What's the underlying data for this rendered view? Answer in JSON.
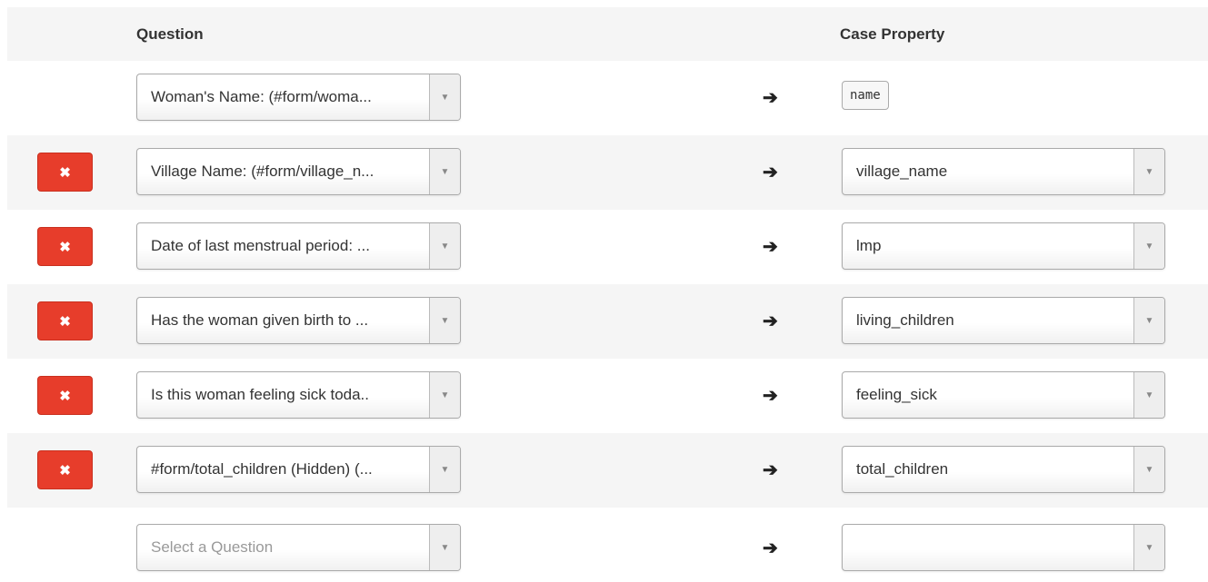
{
  "headers": {
    "question": "Question",
    "case_property": "Case Property"
  },
  "delete_symbol": "✖",
  "dropdown_symbol": "▼",
  "mapping_arrow": "➔",
  "rows": [
    {
      "question": "Woman's Name: (#form/woma...",
      "property": "name",
      "property_fixed": true,
      "deletable": false
    },
    {
      "question": "Village Name: (#form/village_n...",
      "property": "village_name",
      "deletable": true
    },
    {
      "question": "Date of last menstrual period: ...",
      "property": "lmp",
      "deletable": true
    },
    {
      "question": "Has the woman given birth to ...",
      "property": "living_children",
      "deletable": true
    },
    {
      "question": "Is this woman feeling sick toda..",
      "property": "feeling_sick",
      "deletable": true
    },
    {
      "question": "#form/total_children (Hidden) (...",
      "property": "total_children",
      "deletable": true
    },
    {
      "question": "",
      "question_placeholder": "Select a Question",
      "property": "",
      "deletable": false
    }
  ],
  "colors": {
    "delete_button": "#e73d2b",
    "row_shade": "#f5f5f5"
  }
}
